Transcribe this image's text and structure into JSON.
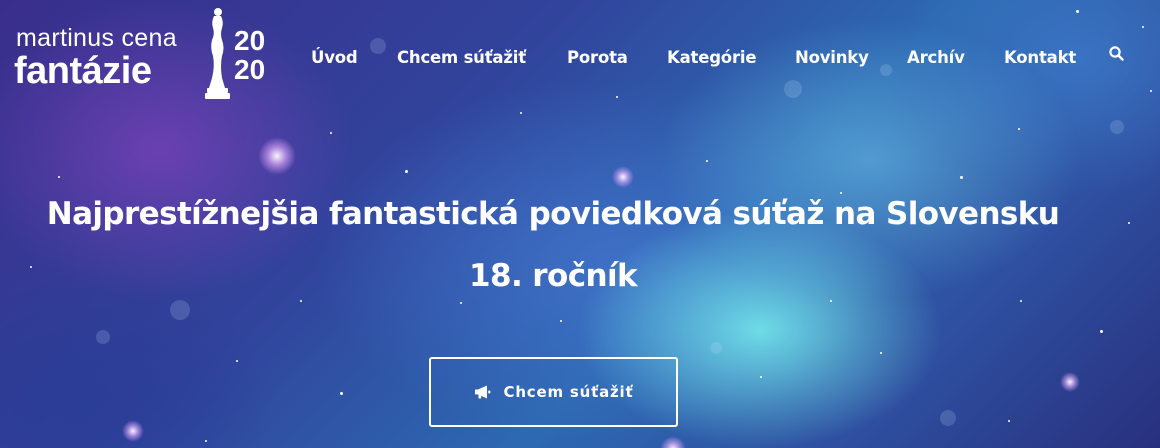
{
  "logo": {
    "line1": "martinus cena",
    "line2": "fantázie",
    "year_top": "20",
    "year_bottom": "20",
    "statue_icon": "trophy-statue-icon"
  },
  "nav": {
    "items": [
      {
        "label": "Úvod"
      },
      {
        "label": "Chcem súťažiť"
      },
      {
        "label": "Porota"
      },
      {
        "label": "Kategórie"
      },
      {
        "label": "Novinky"
      },
      {
        "label": "Archív"
      },
      {
        "label": "Kontakt"
      }
    ],
    "search_icon": "search-icon"
  },
  "hero": {
    "headline": "Najprestížnejšia fantastická poviedková súťaž na Slovensku",
    "edition": "18. ročník",
    "cta_label": "Chcem súťažiť",
    "cta_icon": "megaphone-icon"
  },
  "colors": {
    "text": "#ffffff",
    "background_deep": "#2d2f8a",
    "nebula_cyan": "#78f0f0",
    "nebula_purple": "#9646c8"
  }
}
